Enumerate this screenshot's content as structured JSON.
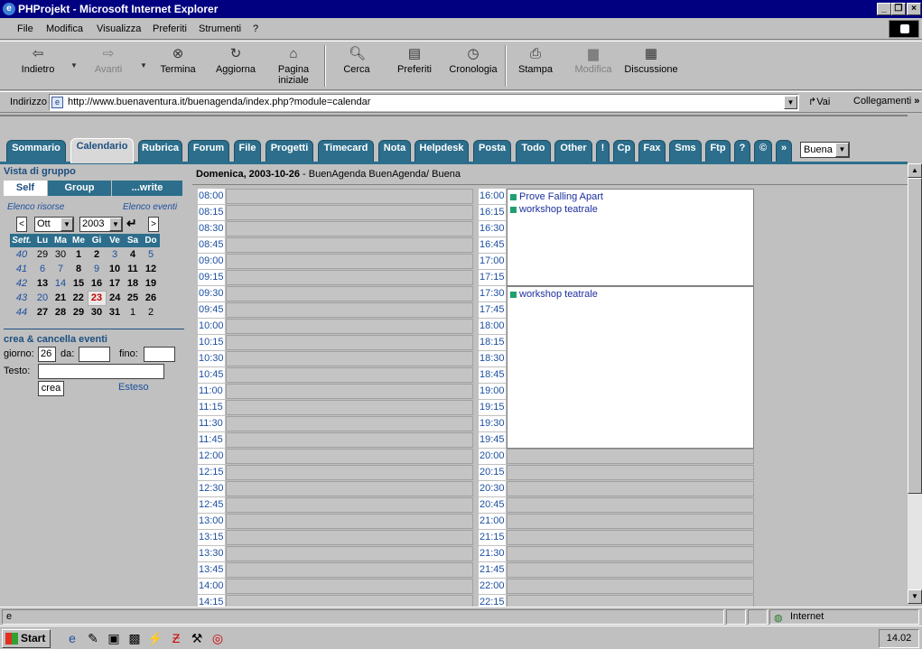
{
  "window": {
    "title": "PHProjekt - Microsoft Internet Explorer"
  },
  "menu": [
    "File",
    "Modifica",
    "Visualizza",
    "Preferiti",
    "Strumenti",
    "?"
  ],
  "toolbar": {
    "back": "Indietro",
    "forward": "Avanti",
    "stop": "Termina",
    "refresh": "Aggiorna",
    "home_line1": "Pagina",
    "home_line2": "iniziale",
    "search": "Cerca",
    "favorites": "Preferiti",
    "history": "Cronologia",
    "print": "Stampa",
    "edit": "Modifica",
    "discuss": "Discussione"
  },
  "address": {
    "label": "Indirizzo",
    "url": "http://www.buenaventura.it/buenagenda/index.php?module=calendar",
    "go": "Vai",
    "links": "Collegamenti"
  },
  "tabs": [
    "Sommario",
    "Calendario",
    "Rubrica",
    "Forum",
    "File",
    "Progetti",
    "Timecard",
    "Nota",
    "Helpdesk",
    "Posta",
    "Todo",
    "Other",
    "!",
    "Cp",
    "Fax",
    "Sms",
    "Ftp",
    "?",
    "©",
    "»"
  ],
  "active_tab": "Calendario",
  "user_select": "Buena",
  "left": {
    "group_view_title": "Vista di gruppo",
    "btn_self": "Self",
    "btn_group": "Group",
    "btn_write": "...write",
    "resources_link": "Elenco risorse",
    "events_link": "Elenco eventi",
    "month_value": "Ott",
    "year_value": "2003",
    "prev": "<",
    "next": ">",
    "weekday_headers": [
      "Sett.",
      "Lu",
      "Ma",
      "Me",
      "Gi",
      "Ve",
      "Sa",
      "Do"
    ],
    "weeks": [
      {
        "wk": "40",
        "days": [
          "29",
          "30",
          "1",
          "2",
          "3",
          "4",
          "5"
        ]
      },
      {
        "wk": "41",
        "days": [
          "6",
          "7",
          "8",
          "9",
          "10",
          "11",
          "12"
        ]
      },
      {
        "wk": "42",
        "days": [
          "13",
          "14",
          "15",
          "16",
          "17",
          "18",
          "19"
        ]
      },
      {
        "wk": "43",
        "days": [
          "20",
          "21",
          "22",
          "23",
          "24",
          "25",
          "26"
        ]
      },
      {
        "wk": "44",
        "days": [
          "27",
          "28",
          "29",
          "30",
          "31",
          "1",
          "2"
        ]
      }
    ],
    "events_title": "crea & cancella eventi",
    "day_label": "giorno:",
    "day_value": "26",
    "from_label": "da:",
    "to_label": "fino:",
    "text_label": "Testo:",
    "create_btn": "crea",
    "extended_link": "Esteso"
  },
  "calendar": {
    "date_heading": "Domenica, 2003-10-26",
    "subheading": "- BuenAgenda BuenAgenda/ Buena",
    "left_times": [
      "08:00",
      "08:15",
      "08:30",
      "08:45",
      "09:00",
      "09:15",
      "09:30",
      "09:45",
      "10:00",
      "10:15",
      "10:30",
      "10:45",
      "11:00",
      "11:15",
      "11:30",
      "11:45",
      "12:00",
      "12:15",
      "12:30",
      "12:45",
      "13:00",
      "13:15",
      "13:30",
      "13:45",
      "14:00",
      "14:15"
    ],
    "right_times": [
      "16:00",
      "16:15",
      "16:30",
      "16:45",
      "17:00",
      "17:15",
      "17:30",
      "17:45",
      "18:00",
      "18:15",
      "18:30",
      "18:45",
      "19:00",
      "19:15",
      "19:30",
      "19:45",
      "20:00",
      "20:15",
      "20:30",
      "20:45",
      "21:00",
      "21:15",
      "21:30",
      "21:45",
      "22:00",
      "22:15"
    ],
    "events_a": [
      "Prove Falling Apart",
      "workshop teatrale"
    ],
    "events_b": [
      "workshop teatrale"
    ]
  },
  "status": {
    "zone": "Internet"
  },
  "taskbar": {
    "start": "Start",
    "clock": "14.02"
  }
}
